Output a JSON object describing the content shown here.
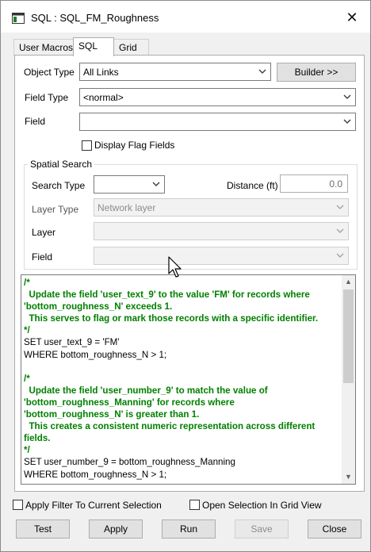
{
  "window": {
    "title": "SQL : SQL_FM_Roughness",
    "close_glyph": "✕"
  },
  "tabs": [
    {
      "label": "User Macros",
      "active": false
    },
    {
      "label": "SQL",
      "active": true
    },
    {
      "label": "Grid",
      "active": false
    }
  ],
  "form": {
    "object_type_label": "Object Type",
    "object_type_value": "All Links",
    "builder_button": "Builder >>",
    "field_type_label": "Field Type",
    "field_type_value": "<normal>",
    "field_label": "Field",
    "field_value": "",
    "display_flag_label": "Display Flag Fields",
    "display_flag_checked": false
  },
  "spatial": {
    "group_label": "Spatial Search",
    "search_type_label": "Search Type",
    "search_type_value": "",
    "distance_label": "Distance (ft)",
    "distance_value": "0.0",
    "layer_type_label": "Layer Type",
    "layer_type_value": "Network layer",
    "layer_label": "Layer",
    "layer_value": "",
    "field_label": "Field",
    "field_value": ""
  },
  "sql": {
    "lines": [
      {
        "text": "/*",
        "kind": "comment"
      },
      {
        "text": "  Update the field 'user_text_9' to the value 'FM' for records where",
        "kind": "comment"
      },
      {
        "text": "'bottom_roughness_N' exceeds 1.",
        "kind": "comment"
      },
      {
        "text": "  This serves to flag or mark those records with a specific identifier.",
        "kind": "comment"
      },
      {
        "text": "*/",
        "kind": "comment"
      },
      {
        "text": "SET user_text_9 = 'FM'",
        "kind": "code"
      },
      {
        "text": "WHERE bottom_roughness_N > 1;",
        "kind": "code"
      },
      {
        "text": "",
        "kind": "code"
      },
      {
        "text": "/*",
        "kind": "comment"
      },
      {
        "text": "  Update the field 'user_number_9' to match the value of",
        "kind": "comment"
      },
      {
        "text": "'bottom_roughness_Manning' for records where",
        "kind": "comment"
      },
      {
        "text": "'bottom_roughness_N' is greater than 1.",
        "kind": "comment"
      },
      {
        "text": "  This creates a consistent numeric representation across different",
        "kind": "comment"
      },
      {
        "text": "fields.",
        "kind": "comment"
      },
      {
        "text": "*/",
        "kind": "comment"
      },
      {
        "text": "SET user_number_9 = bottom_roughness_Manning",
        "kind": "code"
      },
      {
        "text": "WHERE bottom_roughness_N > 1;",
        "kind": "code"
      }
    ]
  },
  "options": {
    "apply_filter_label": "Apply Filter To Current Selection",
    "apply_filter_checked": false,
    "open_selection_label": "Open Selection In Grid View",
    "open_selection_checked": false
  },
  "buttons": {
    "test": "Test",
    "apply": "Apply",
    "run": "Run",
    "save": "Save",
    "close": "Close"
  },
  "colors": {
    "comment": "#008000",
    "window_bg": "#f0f0f0",
    "panel_bg": "#ffffff"
  }
}
